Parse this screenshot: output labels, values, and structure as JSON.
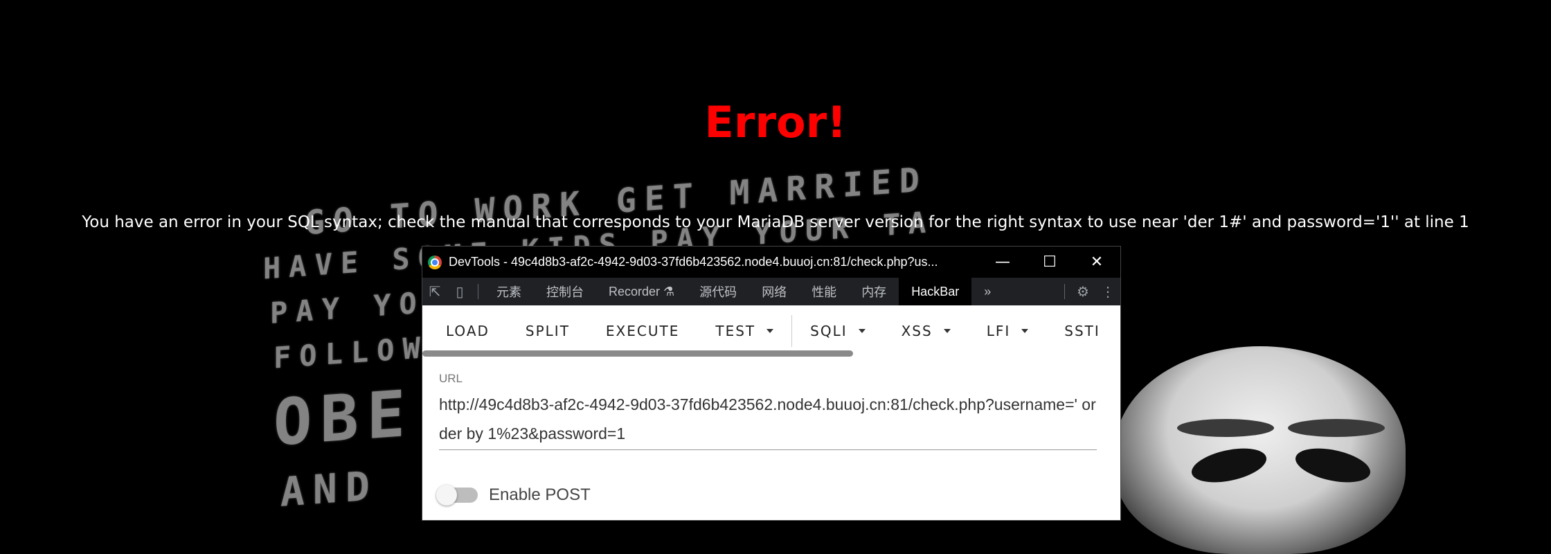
{
  "page": {
    "error_title": "Error!",
    "error_message": "You have an error in your SQL syntax; check the manual that corresponds to your MariaDB server version for the right syntax to use near 'der 1#' and password='1'' at line 1"
  },
  "devtools": {
    "title": "DevTools - 49c4d8b3-af2c-4942-9d03-37fd6b423562.node4.buuoj.cn:81/check.php?us...",
    "tabs": [
      "元素",
      "控制台",
      "Recorder",
      "源代码",
      "网络",
      "性能",
      "内存",
      "HackBar"
    ],
    "active_tab": "HackBar",
    "more_tabs": "»"
  },
  "hackbar": {
    "buttons": [
      "LOAD",
      "SPLIT",
      "EXECUTE",
      "TEST",
      "SQLI",
      "XSS",
      "LFI",
      "SSTI"
    ],
    "url_label": "URL",
    "url_value": "http://49c4d8b3-af2c-4942-9d03-37fd6b423562.node4.buuoj.cn:81/check.php?username=' order by 1%23&password=1",
    "enable_post_label": "Enable POST",
    "enable_post": false
  },
  "icons": {
    "minimize": "minimize-icon",
    "maximize": "maximize-icon",
    "close": "close-icon",
    "settings": "gear-icon",
    "menu": "kebab-menu-icon"
  },
  "colors": {
    "error": "#ff0000",
    "background": "#000000",
    "devtools_tabbar": "#202124"
  }
}
